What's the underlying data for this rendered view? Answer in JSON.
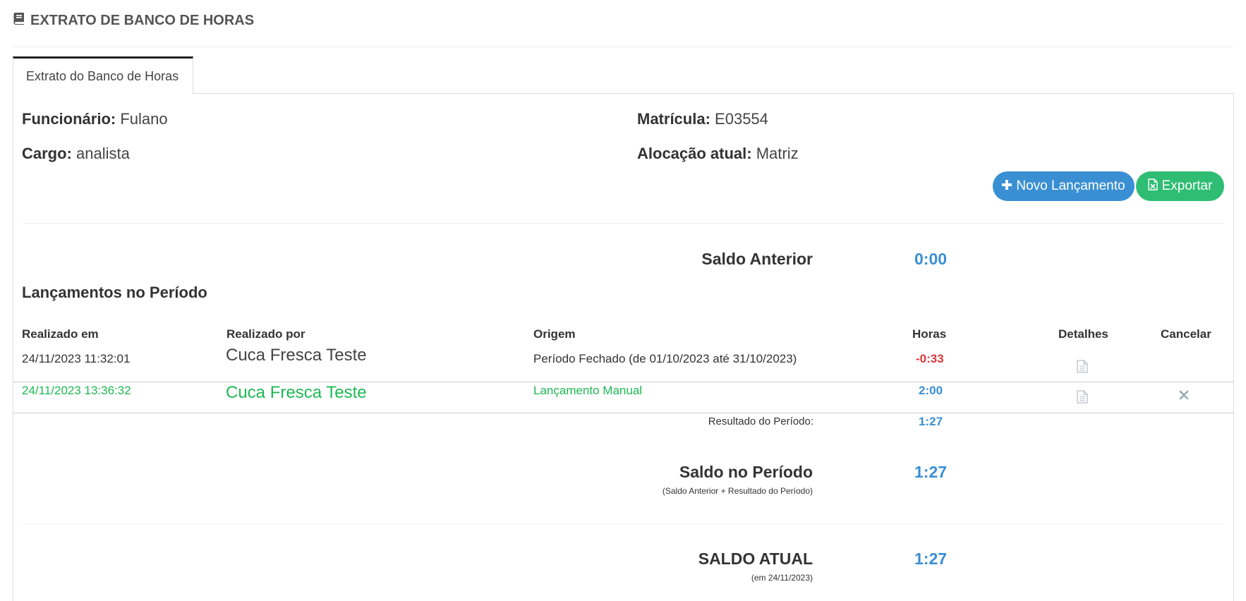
{
  "page": {
    "title": "EXTRATO DE BANCO DE HORAS",
    "title_icon": "book-icon"
  },
  "tabs": [
    {
      "label": "Extrato do Banco de Horas",
      "active": true
    }
  ],
  "employee": {
    "funcionario_label": "Funcionário:",
    "funcionario_value": "Fulano",
    "matricula_label": "Matrícula:",
    "matricula_value": "E03554",
    "cargo_label": "Cargo:",
    "cargo_value": "analista",
    "alocacao_label": "Alocação atual:",
    "alocacao_value": "Matriz"
  },
  "actions": {
    "novo_label": "Novo Lançamento",
    "novo_icon": "plus-icon",
    "exportar_label": "Exportar",
    "exportar_icon": "excel-file-icon",
    "novo_color": "#3a8fd3",
    "exportar_color": "#2ebd72"
  },
  "saldo_anterior": {
    "label": "Saldo Anterior",
    "value": "0:00"
  },
  "lancamentos": {
    "title": "Lançamentos no Período",
    "columns": [
      "Realizado em",
      "Realizado por",
      "Origem",
      "Horas",
      "Detalhes",
      "Cancelar"
    ],
    "rows": [
      {
        "data": "24/11/2023 11:32:01",
        "por": "Cuca Fresca Teste",
        "origem": "Período Fechado (de 01/10/2023 até 31/10/2023)",
        "horas": "-0:33",
        "detalhes_icon": "document-icon",
        "cancelavel": false
      },
      {
        "data": "24/11/2023 13:36:32",
        "por": "Cuca Fresca Teste",
        "origem": "Lançamento Manual",
        "horas": "2:00",
        "detalhes_icon": "document-icon",
        "cancelavel": true,
        "cancel_icon": "close-icon"
      }
    ]
  },
  "resultado_periodo": {
    "label": "Resultado do Período:",
    "value": "1:27"
  },
  "saldo_periodo": {
    "label": "Saldo no Período",
    "sublabel": "(Saldo Anterior + Resultado do Período)",
    "value": "1:27"
  },
  "saldo_atual": {
    "label": "SALDO ATUAL",
    "sublabel": "(em 24/11/2023)",
    "value": "1:27"
  },
  "colors": {
    "positive": "#3a8fd3",
    "negative": "#d9383a",
    "manual": "#1db954"
  }
}
